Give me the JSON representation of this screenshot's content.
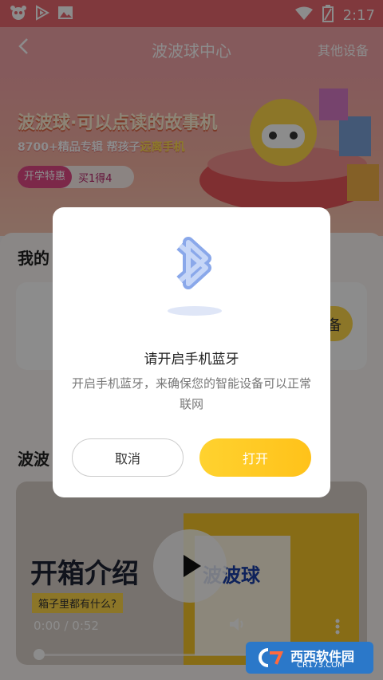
{
  "status_bar": {
    "time": "2:17",
    "icons": [
      "panda-app-icon",
      "play-store-icon",
      "image-icon",
      "wifi-icon",
      "battery-icon"
    ]
  },
  "header": {
    "title": "波波球中心",
    "back_icon": "back-chevron-icon",
    "right_link": "其他设备"
  },
  "banner": {
    "title": "波波球·可以点读的故事机",
    "subtitle_prefix": "8700+精品专辑  帮孩子",
    "subtitle_highlight": "远离手机",
    "badge_left": "开学特惠",
    "badge_right": "买1得4"
  },
  "sections": {
    "my_devices_title": "我的",
    "device_button": "备",
    "video_section_title": "波波"
  },
  "video": {
    "title": "开箱介绍",
    "chip": "箱子里都有什么?",
    "time": "0:00 / 0:52",
    "box_label": "波波球"
  },
  "dialog": {
    "icon": "bluetooth-icon",
    "title": "请开启手机蓝牙",
    "description": "开启手机蓝牙，来确保您的智能设备可以正常联网",
    "cancel": "取消",
    "confirm": "打开"
  },
  "watermark": {
    "text": "西西软件园",
    "sub": "CR173.COM"
  },
  "colors": {
    "accent_yellow": "#FFC21A",
    "header_pink": "#F3A4A8",
    "bluetooth_blue": "#7B9FE6"
  }
}
